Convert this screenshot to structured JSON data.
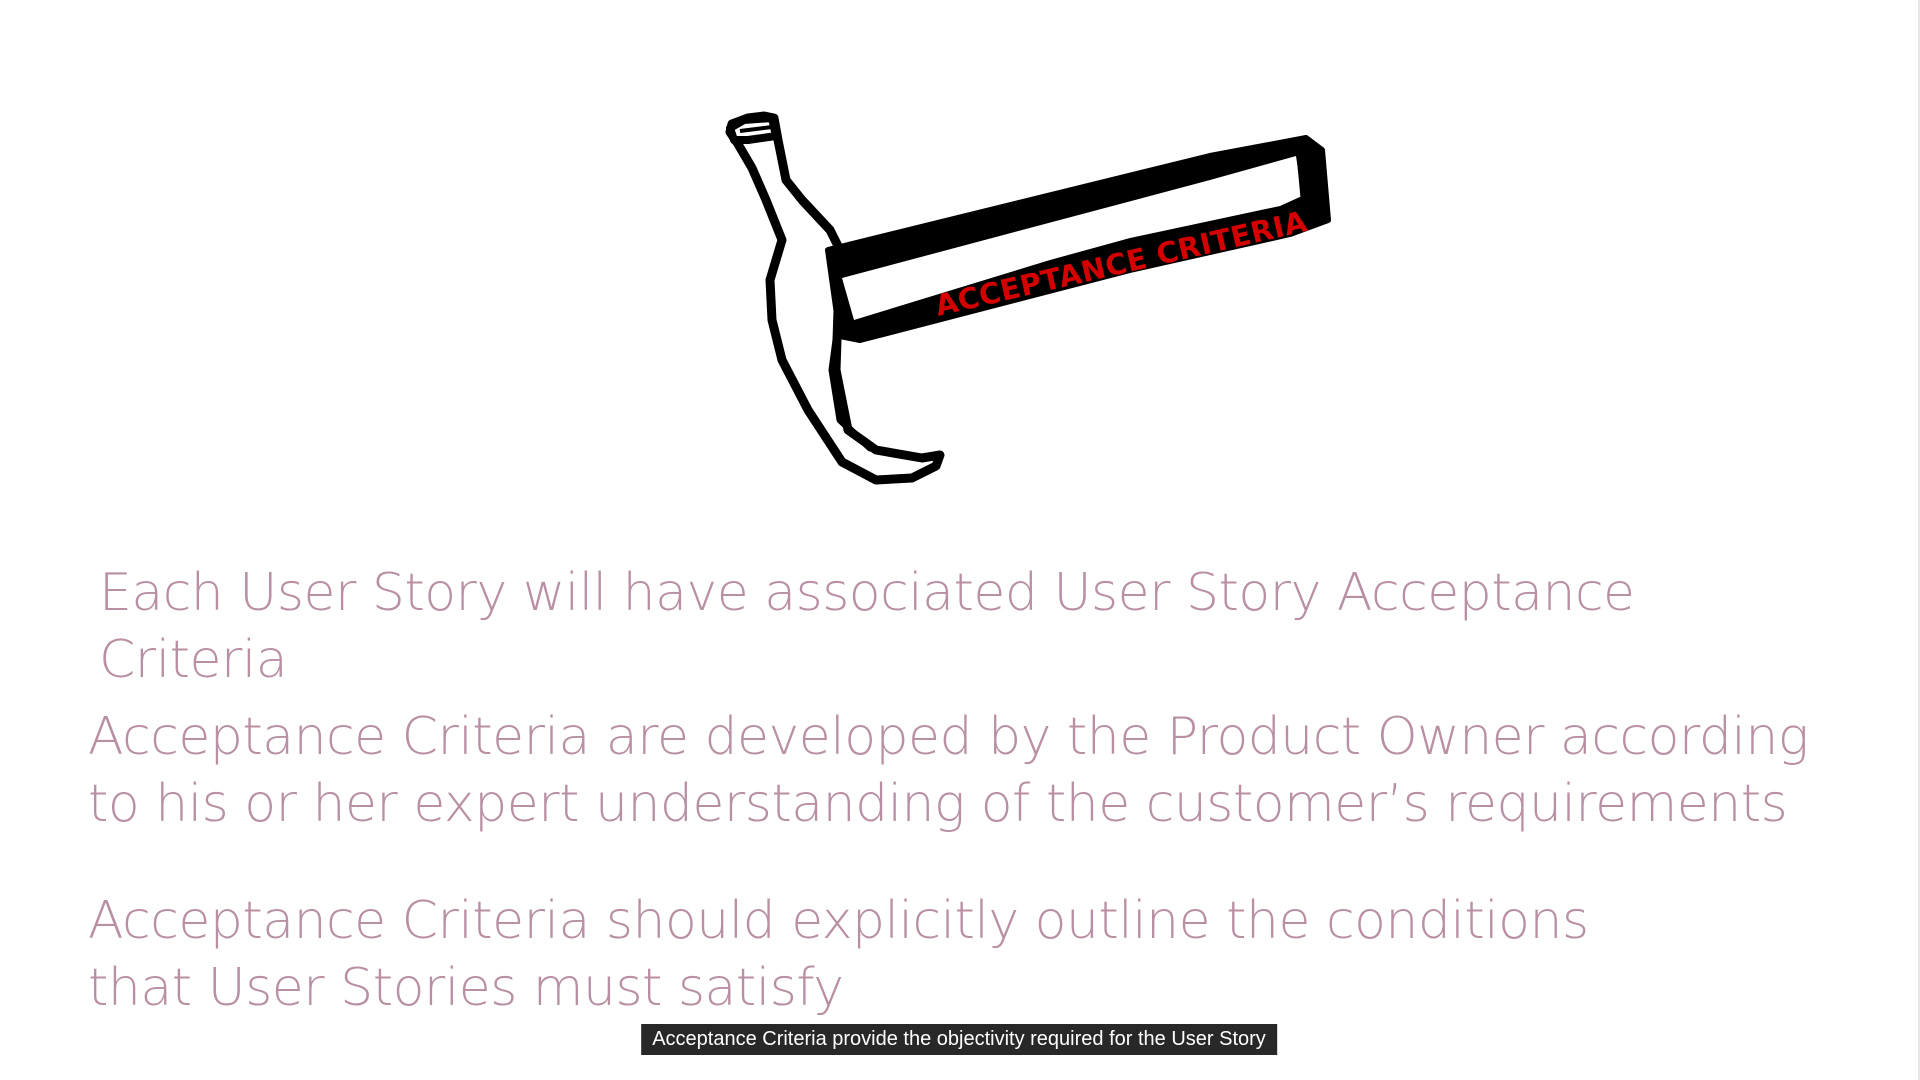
{
  "slide": {
    "hammer_label": "ACCEPTANCE CRITERIA",
    "bullets": [
      "Each User Story will have associated User Story Acceptance\nCriteria",
      "Acceptance Criteria are developed by the Product Owner according\nto his or her expert understanding of the customer’s requirements",
      "Acceptance Criteria should explicitly outline the conditions\nthat User Stories must satisfy"
    ]
  },
  "caption": {
    "text": "Acceptance Criteria provide the objectivity required for the User Story"
  },
  "colors": {
    "bullet_text": "#b88fa3",
    "hammer_label": "#d40000",
    "caption_bg": "#0a0a0a"
  },
  "icons": [
    "hammer-icon"
  ]
}
